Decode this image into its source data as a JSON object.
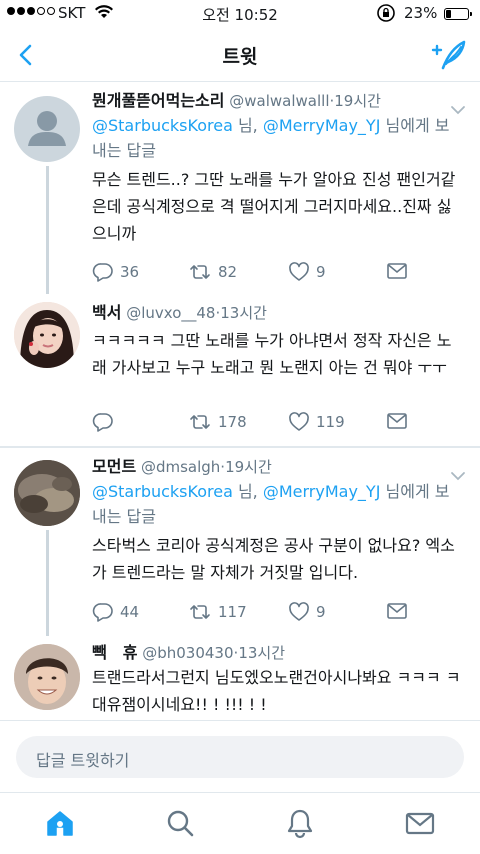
{
  "status_bar": {
    "carrier": "SKT",
    "time": "오전 10:52",
    "battery_percent": "23%"
  },
  "nav": {
    "title": "트윗"
  },
  "tweets": [
    {
      "name": "뭔개풀뜯어먹는소리",
      "handle": "@walwalwalll",
      "time": "19시간",
      "replying_mention_1": "@StarbucksKorea",
      "replying_sep": " 님, ",
      "replying_mention_2": "@MerryMay_YJ",
      "replying_suffix": " 님에게 보내는 답글",
      "text": "무슨 트렌드..? 그딴 노래를 누가 알아요 진성 팬인거같은데 공식계정으로 격 떨어지게 그러지마세요..진짜 싫으니까",
      "replies": "36",
      "retweets": "82",
      "likes": "9"
    },
    {
      "name": "백서",
      "handle": "@luvxo__48",
      "time": "13시간",
      "text": "ㅋㅋㅋㅋㅋ 그딴 노래를 누가 아냐면서 정작 자신은 노래 가사보고 누구 노래고 뭔 노랜지  아는 건 뭐야 ㅜㅜ",
      "replies": "",
      "retweets": "178",
      "likes": "119"
    },
    {
      "name": "모먼트",
      "handle": "@dmsalgh",
      "time": "19시간",
      "replying_mention_1": "@StarbucksKorea",
      "replying_sep": " 님, ",
      "replying_mention_2": "@MerryMay_YJ",
      "replying_suffix": " 님에게 보내는 답글",
      "text": "스타벅스 코리아 공식계정은 공사 구분이 없나요? 엑소가 트렌드라는 말 자체가 거짓말 입니다.",
      "replies": "44",
      "retweets": "117",
      "likes": "9"
    },
    {
      "name": "빽　휴",
      "handle": "@bh030430",
      "time": "13시간",
      "text": "트랜드라서그런지 님도엤오노랜건아시나봐요 ㅋㅋㅋ ㅋ 대유잼이시네요!! ! !!! ! !"
    }
  ],
  "reply_bar": {
    "placeholder": "답글 트윗하기"
  },
  "tab_bar": {
    "tabs": [
      "home-icon",
      "search-icon",
      "notifications-icon",
      "messages-icon"
    ],
    "active_color": "#1da1f2",
    "inactive_color": "#657786"
  },
  "colors": {
    "accent": "#1da1f2",
    "muted": "#657786",
    "divider": "#e1e8ed"
  }
}
